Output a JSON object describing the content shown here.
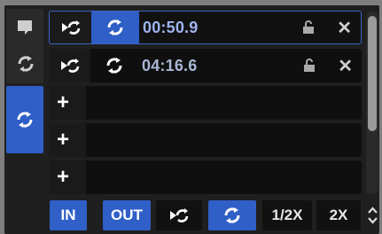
{
  "rows": [
    {
      "time": "00:50.9",
      "active": true
    },
    {
      "time": "04:16.6",
      "active": false
    },
    {
      "empty": true
    },
    {
      "empty": true
    },
    {
      "empty": true
    }
  ],
  "bottom": {
    "in_label": "IN",
    "out_label": "OUT",
    "half_label": "1/2X",
    "double_label": "2X"
  },
  "icons": {
    "plus": "+",
    "close": "✕"
  },
  "colors": {
    "accent_blue": "#2f5fc7",
    "time_text": "#9fb4ee",
    "panel_bg": "#1f1f1f",
    "page_bg": "#7f7f7f"
  }
}
